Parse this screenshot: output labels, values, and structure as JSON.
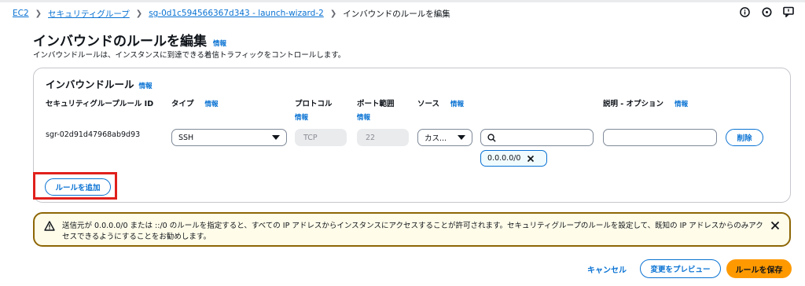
{
  "breadcrumb": {
    "items": [
      "EC2",
      "セキュリティグループ",
      "sg-0d1c594566367d343 - launch-wizard-2"
    ],
    "current": "インバウンドのルールを編集"
  },
  "top_icons": [
    "info-circle-icon",
    "notification-icon",
    "feedback-icon"
  ],
  "page": {
    "title": "インバウンドのルールを編集",
    "info": "情報",
    "description": "インバウンドルールは、インスタンスに到達できる着信トラフィックをコントロールします。"
  },
  "rules_panel": {
    "title": "インバウンドルール",
    "info": "情報",
    "columns": {
      "rule_id": "セキュリティグループルール ID",
      "type": "タイプ",
      "protocol": "プロトコル",
      "port_range": "ポート範囲",
      "source": "ソース",
      "description": "説明 - オプション",
      "info": "情報"
    },
    "rule": {
      "id": "sgr-02d91d47968ab9d93",
      "type": "SSH",
      "protocol": "TCP",
      "port": "22",
      "source_type": "カス...",
      "search_value": "",
      "description_value": "",
      "cidr_token": "0.0.0.0/0",
      "delete_label": "削除"
    },
    "add_rule_label": "ルールを追加"
  },
  "alert": {
    "text": "送信元が 0.0.0.0/0 または ::/0 のルールを指定すると、すべての IP アドレスからインスタンスにアクセスすることが許可されます。セキュリティグループのルールを設定して、既知の IP アドレスからのみアクセスできるようにすることをお勧めします。"
  },
  "footer": {
    "cancel_label": "キャンセル",
    "preview_label": "変更をプレビュー",
    "save_label": "ルールを保存"
  },
  "colors": {
    "link": "#0972d3",
    "primary": "#ff9900",
    "warning_border": "#8d6605",
    "highlight": "#e0201c"
  }
}
